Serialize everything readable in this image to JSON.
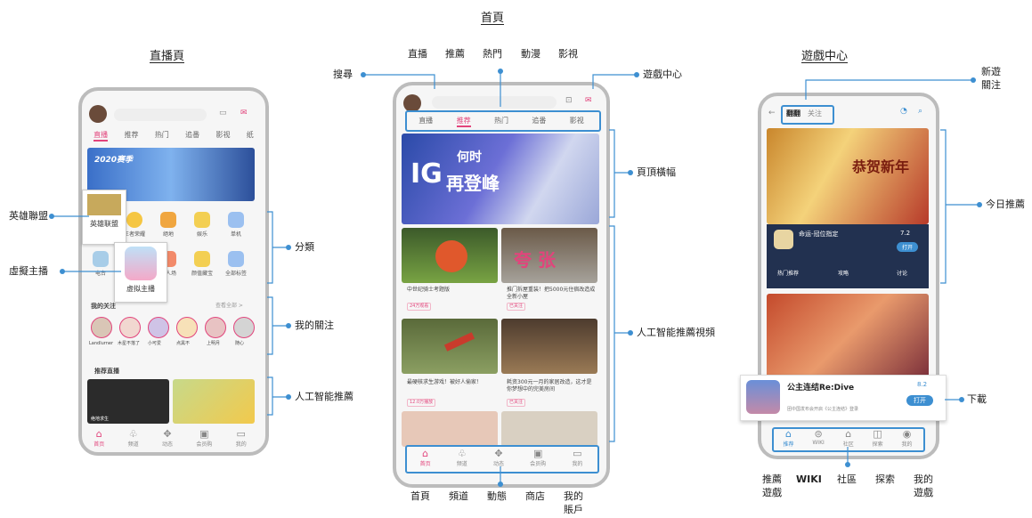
{
  "sections": {
    "left_title": "直播頁",
    "center_title": "首頁",
    "right_title": "遊戲中心"
  },
  "left_phone": {
    "tabs": [
      "直播",
      "推荐",
      "热门",
      "追番",
      "影视",
      "纸"
    ],
    "banner_text": "2020赛季",
    "popup_label_1": "英雄联盟",
    "popup_label_2": "虚拟主播",
    "categories_row1": [
      "",
      "王者荣耀",
      "絕地",
      "娱乐",
      "单机"
    ],
    "categories_row2": [
      "电台",
      "",
      "五人场",
      "颜值藏宝",
      "全部标签"
    ],
    "follow_header": "我的关注",
    "follow_more": "查看全部 >",
    "follow_names": [
      "Landlurner",
      "木星不落了",
      "小可爱",
      "点黑不",
      "上明月",
      "随心"
    ],
    "recommend_header": "推荐直播",
    "thumb_caption_1": "绝地求生",
    "thumb_caption_2": "",
    "bottom_nav": [
      "首页",
      "频道",
      "动态",
      "会员购",
      "我的"
    ]
  },
  "center_phone": {
    "tabs": [
      "直播",
      "推荐",
      "热门",
      "追番",
      "影视"
    ],
    "banner_text_1": "IG",
    "banner_text_2": "何时",
    "banner_text_3": "再登峰",
    "card1_title": "中世纪骑士考题版",
    "card1_tag": "24万观看",
    "card2_title": "推门拆屋重装！把5000元住宿改造成全新小屋",
    "card2_tag": "已关注",
    "card2_text": "夸 张",
    "card3_title": "最硬核求生游戏！被好人偷家！",
    "card3_tag": "12.0万播放",
    "card4_title": "耗资300元一月的家居改造，这才是你梦想中的完美房间",
    "card4_tag": "已关注",
    "bottom_nav": [
      "首页",
      "频道",
      "动态",
      "会员购",
      "我的"
    ]
  },
  "right_phone": {
    "tab_active": "翻翻",
    "tab_follow": "关注",
    "banner_title": "恭贺新年",
    "game1_name": "命运-冠位指定",
    "game1_rating": "7.2",
    "game1_button": "打开",
    "game1_actions": [
      "热门推荐",
      "攻略",
      "讨论"
    ],
    "game2_name": "公主连结Re:Dive",
    "game2_rating": "8.2",
    "game2_button": "打开",
    "game2_desc": "团中国发布会开启《公主连结》登录",
    "bottom_nav": [
      "推荐",
      "WIKI",
      "社区",
      "探索",
      "我的"
    ]
  },
  "annotations": {
    "search": "搜尋",
    "top_tabs": [
      "直播",
      "推薦",
      "熱門",
      "動漫",
      "影視"
    ],
    "game_center": "遊戲中心",
    "top_banner": "頁頂橫幅",
    "ai_videos": "人工智能推薦視頻",
    "bottom_nav": [
      "首頁",
      "頻道",
      "動態",
      "商店",
      "我的"
    ],
    "account": "賬戶",
    "lol": "英雄聯盟",
    "vtuber": "虛擬主播",
    "categories": "分類",
    "my_follow": "我的關注",
    "ai_recommend": "人工智能推薦",
    "new_game": "新遊",
    "follow": "關注",
    "today": "今日推薦",
    "download": "下載",
    "rec_game_1": "推薦",
    "rec_game_2": "遊戲",
    "wiki": "WIKI",
    "community": "社區",
    "explore": "探索",
    "my_1": "我的",
    "my_2": "遊戲"
  }
}
